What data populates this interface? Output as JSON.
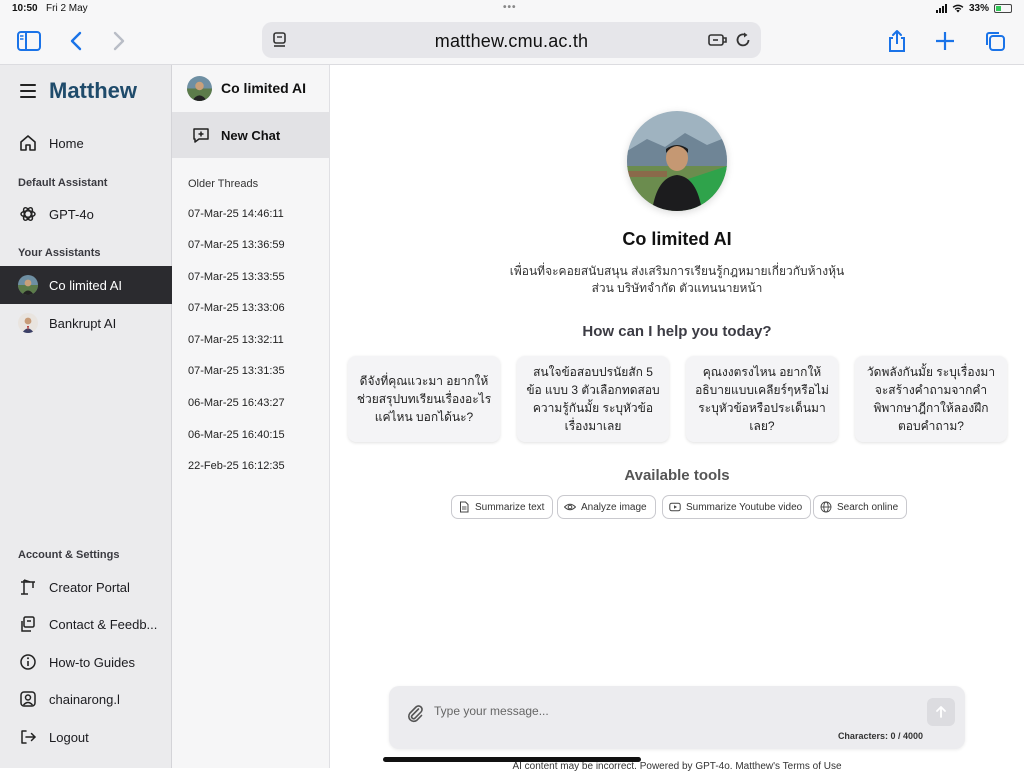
{
  "statusbar": {
    "time": "10:50",
    "date": "Fri 2 May",
    "battery": "33%"
  },
  "browser": {
    "url": "matthew.cmu.ac.th",
    "accent": "#1a73e8"
  },
  "sidebar": {
    "brand": "Matthew",
    "brand_color": "#1f4b6b",
    "home": "Home",
    "default_assistant_label": "Default Assistant",
    "default_assistant": "GPT-4o",
    "your_assistants_label": "Your Assistants",
    "assistants": [
      {
        "label": "Co limited AI",
        "active": true
      },
      {
        "label": "Bankrupt AI",
        "active": false
      }
    ],
    "account_label": "Account & Settings",
    "account_items": [
      {
        "label": "Creator Portal",
        "icon": "crane-icon"
      },
      {
        "label": "Contact & Feedb...",
        "icon": "contact-icon"
      },
      {
        "label": "How-to Guides",
        "icon": "info-icon"
      },
      {
        "label": "chainarong.l",
        "icon": "user-icon"
      },
      {
        "label": "Logout",
        "icon": "logout-icon"
      }
    ]
  },
  "threads": {
    "assistant_name": "Co limited AI",
    "new_chat": "New Chat",
    "older_label": "Older Threads",
    "items": [
      "07-Mar-25 14:46:11",
      "07-Mar-25 13:36:59",
      "07-Mar-25 13:33:55",
      "07-Mar-25 13:33:06",
      "07-Mar-25 13:32:11",
      "07-Mar-25 13:31:35",
      "06-Mar-25 16:43:27",
      "06-Mar-25 16:40:15",
      "22-Feb-25 16:12:35"
    ]
  },
  "main": {
    "title": "Co limited AI",
    "description": "เพื่อนที่จะคอยสนับสนุน ส่งเสริมการเรียนรู้กฎหมายเกี่ยวกับห้างหุ้นส่วน บริษัทจำกัด ตัวแทนนายหน้า",
    "help_heading": "How can I help you today?",
    "prompts": [
      "ดีจังที่คุณแวะมา อยากให้ช่วยสรุปบทเรียนเรื่องอะไรแค่ไหน บอกได้นะ?",
      "สนใจข้อสอบปรนัยสัก 5 ข้อ แบบ 3 ตัวเลือกทดสอบความรู้กันมั้ย ระบุหัวข้อเรื่องมาเลย",
      "คุณงงตรงไหน อยากให้อธิบายแบบเคลียร์ๆหรือไม่ ระบุหัวข้อหรือประเด็นมาเลย?",
      "วัดพลังกันมั้ย ระบุเรื่องมา จะสร้างคำถามจากคำพิพากษาฎีกาให้ลองฝึกตอบคำถาม?"
    ],
    "tools_heading": "Available tools",
    "tools": [
      {
        "label": "Summarize text",
        "icon": "document-icon"
      },
      {
        "label": "Analyze image",
        "icon": "eye-icon"
      },
      {
        "label": "Summarize Youtube video",
        "icon": "youtube-icon"
      },
      {
        "label": "Search online",
        "icon": "globe-icon"
      }
    ],
    "composer": {
      "placeholder": "Type your message...",
      "counter": "Characters: 0 / 4000"
    },
    "disclaimer": "AI content may be incorrect. Powered by GPT-4o. Matthew's Terms of Use"
  }
}
